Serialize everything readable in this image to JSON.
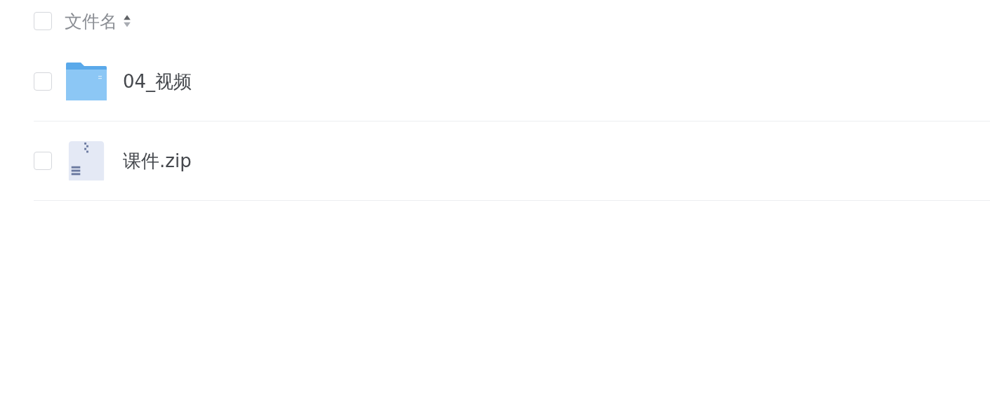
{
  "header": {
    "checked": false,
    "column": "文件名"
  },
  "files": [
    {
      "kind": "folder",
      "name": "04_视频",
      "checked": false
    },
    {
      "kind": "zip",
      "name": "课件.zip",
      "checked": false
    }
  ]
}
